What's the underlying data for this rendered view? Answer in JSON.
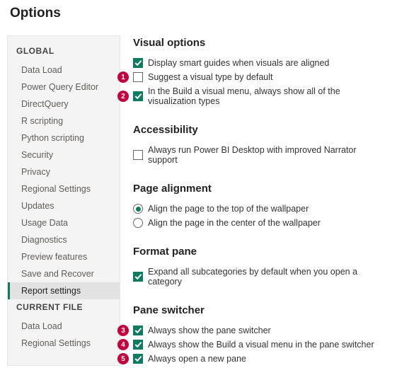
{
  "title": "Options",
  "sidebar": {
    "groups": [
      {
        "heading": "GLOBAL",
        "items": [
          {
            "label": "Data Load",
            "active": false
          },
          {
            "label": "Power Query Editor",
            "active": false
          },
          {
            "label": "DirectQuery",
            "active": false
          },
          {
            "label": "R scripting",
            "active": false
          },
          {
            "label": "Python scripting",
            "active": false
          },
          {
            "label": "Security",
            "active": false
          },
          {
            "label": "Privacy",
            "active": false
          },
          {
            "label": "Regional Settings",
            "active": false
          },
          {
            "label": "Updates",
            "active": false
          },
          {
            "label": "Usage Data",
            "active": false
          },
          {
            "label": "Diagnostics",
            "active": false
          },
          {
            "label": "Preview features",
            "active": false
          },
          {
            "label": "Save and Recover",
            "active": false
          },
          {
            "label": "Report settings",
            "active": true
          }
        ]
      },
      {
        "heading": "CURRENT FILE",
        "items": [
          {
            "label": "Data Load",
            "active": false
          },
          {
            "label": "Regional Settings",
            "active": false
          }
        ]
      }
    ]
  },
  "sections": [
    {
      "title": "Visual options",
      "controls": [
        {
          "kind": "checkbox",
          "checked": true,
          "label": "Display smart guides when visuals are aligned",
          "callout": null
        },
        {
          "kind": "checkbox",
          "checked": false,
          "label": "Suggest a visual type by default",
          "callout": "1"
        },
        {
          "kind": "checkbox",
          "checked": true,
          "label": "In the Build a visual menu, always show all of the visualization types",
          "callout": "2"
        }
      ]
    },
    {
      "title": "Accessibility",
      "controls": [
        {
          "kind": "checkbox",
          "checked": false,
          "label": "Always run Power BI Desktop with improved Narrator support",
          "callout": null
        }
      ]
    },
    {
      "title": "Page alignment",
      "controls": [
        {
          "kind": "radio",
          "checked": true,
          "label": "Align the page to the top of the wallpaper",
          "callout": null
        },
        {
          "kind": "radio",
          "checked": false,
          "label": "Align the page in the center of the wallpaper",
          "callout": null
        }
      ]
    },
    {
      "title": "Format pane",
      "controls": [
        {
          "kind": "checkbox",
          "checked": true,
          "label": "Expand all subcategories by default when you open a category",
          "callout": null
        }
      ]
    },
    {
      "title": "Pane switcher",
      "controls": [
        {
          "kind": "checkbox",
          "checked": true,
          "label": "Always show the pane switcher",
          "callout": "3"
        },
        {
          "kind": "checkbox",
          "checked": true,
          "label": "Always show the Build a visual menu in the pane switcher",
          "callout": "4"
        },
        {
          "kind": "checkbox",
          "checked": true,
          "label": "Always open a new pane",
          "callout": "5"
        }
      ]
    }
  ]
}
